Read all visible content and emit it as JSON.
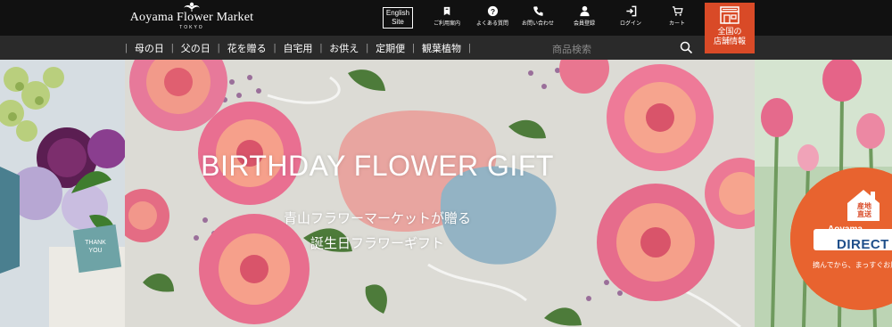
{
  "header": {
    "logo": {
      "name": "Aoyama Flower Market",
      "sub": "TOKYO"
    },
    "english_site": {
      "line1": "English",
      "line2": "Site"
    },
    "utility": [
      {
        "icon": "guide-icon",
        "label": "ご利用案内"
      },
      {
        "icon": "faq-icon",
        "label": "よくある質問"
      },
      {
        "icon": "phone-icon",
        "label": "お問い合わせ"
      },
      {
        "icon": "member-icon",
        "label": "会員登録"
      },
      {
        "icon": "login-icon",
        "label": "ログイン"
      },
      {
        "icon": "cart-icon",
        "label": "カート"
      }
    ],
    "store_button": {
      "icon": "store-icon",
      "line1": "全国の",
      "line2": "店舗情報"
    }
  },
  "nav": {
    "items": [
      "母の日",
      "父の日",
      "花を贈る",
      "自宅用",
      "お供え",
      "定期便",
      "観葉植物"
    ],
    "search_placeholder": "商品検索"
  },
  "hero": {
    "headline": "BIRTHDAY FLOWER GIFT",
    "sub1": "青山フラワーマーケットが贈る",
    "sub2": "誕生日フラワーギフト",
    "left_tag": {
      "line1": "THANK",
      "line2": "YOU"
    },
    "right_badge": {
      "house_line1": "産地",
      "house_line2": "直送",
      "brand": "Aoyama",
      "word": "DIRECT",
      "caption": "摘んでから、まっすぐお届け"
    }
  },
  "colors": {
    "header_bg": "#111111",
    "nav_bg": "#2a2a2a",
    "accent": "#d94a27",
    "badge": "#e8632f",
    "pink_shape": "#e8a5a0",
    "blue_shape": "#93b3c4"
  }
}
